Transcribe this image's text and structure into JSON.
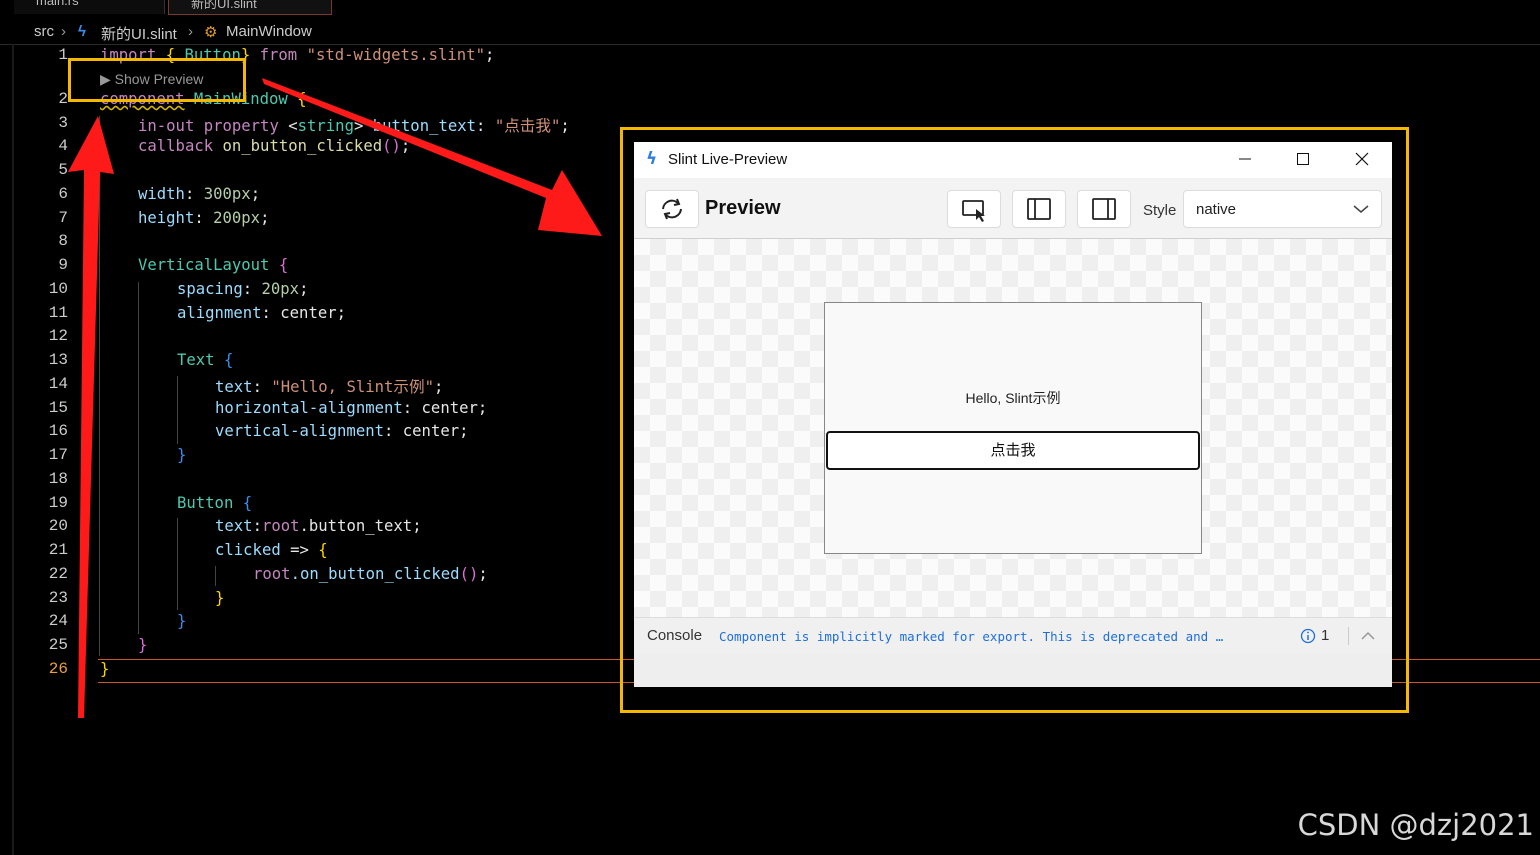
{
  "tabs": [
    {
      "label": "main.rs"
    },
    {
      "label": "新的UI.slint"
    }
  ],
  "breadcrumb": {
    "src": "src",
    "file": "新的UI.slint",
    "component": "MainWindow"
  },
  "editor": {
    "line_numbers": [
      "1",
      "2",
      "3",
      "4",
      "5",
      "6",
      "7",
      "8",
      "9",
      "10",
      "11",
      "12",
      "13",
      "14",
      "15",
      "16",
      "17",
      "18",
      "19",
      "20",
      "21",
      "22",
      "23",
      "24",
      "25",
      "26"
    ],
    "codelens": "▶ Show Preview",
    "code": {
      "l1_kw": "import",
      "l1_b": " { ",
      "l1_id": "Button",
      "l1_c": "} ",
      "l1_from": "from",
      "l1_str": " \"std-widgets.slint\"",
      "l1_end": ";",
      "l2_kw": "component",
      "l2_id": " MainWindow",
      "l2_b": " {",
      "l3_kw": "in-out",
      "l3_kw2": " property",
      "l3_t": " <",
      "l3_type": "string",
      "l3_t2": "> ",
      "l3_name": "button_text",
      "l3_c": ": ",
      "l3_str": "\"点击我\"",
      "l3_end": ";",
      "l4_kw": "callback",
      "l4_name": " on_button_clicked",
      "l4_p": "()",
      "l4_end": ";",
      "l6_p": "width",
      "l6_c": ": ",
      "l6_v": "300px",
      "l6_end": ";",
      "l7_p": "height",
      "l7_c": ": ",
      "l7_v": "200px",
      "l7_end": ";",
      "l9_id": "VerticalLayout",
      "l9_b": " {",
      "l10_p": "spacing",
      "l10_c": ": ",
      "l10_v": "20px",
      "l10_end": ";",
      "l11_p": "alignment",
      "l11_c": ": ",
      "l11_v": "center",
      "l11_end": ";",
      "l13_id": "Text",
      "l13_b": " {",
      "l14_p": "text",
      "l14_c": ": ",
      "l14_str": "\"Hello, Slint示例\"",
      "l14_end": ";",
      "l15_p": "horizontal-alignment",
      "l15_c": ": ",
      "l15_v": "center",
      "l15_end": ";",
      "l16_p": "vertical-alignment",
      "l16_c": ": ",
      "l16_v": "center",
      "l16_end": ";",
      "l17_b": "}",
      "l19_id": "Button",
      "l19_b": " {",
      "l20_p": "text",
      "l20_c": ":",
      "l20_r": "root",
      "l20_v": ".button_text",
      "l20_end": ";",
      "l21_p": "clicked",
      "l21_a": " => ",
      "l21_b": "{",
      "l22_r": "root",
      "l22_v": ".on_button_clicked",
      "l22_p": "()",
      "l22_end": ";",
      "l23_b": "}",
      "l24_b": "}",
      "l25_b": "}",
      "l26_b": "}"
    }
  },
  "preview_window": {
    "title": "Slint Live-Preview",
    "toolbar": {
      "title": "Preview",
      "style_label": "Style",
      "style_value": "native"
    },
    "app": {
      "text": "Hello, Slint示例",
      "button_label": "点击我"
    },
    "console": {
      "label": "Console",
      "message": "Component is implicitly marked for export. This is deprecated and …",
      "info_count": "1"
    }
  },
  "watermark": "CSDN @dzj2021",
  "colors": {
    "highlight": "#f5b800",
    "arrow": "#ff1a1a",
    "link": "#1e6fd9"
  }
}
